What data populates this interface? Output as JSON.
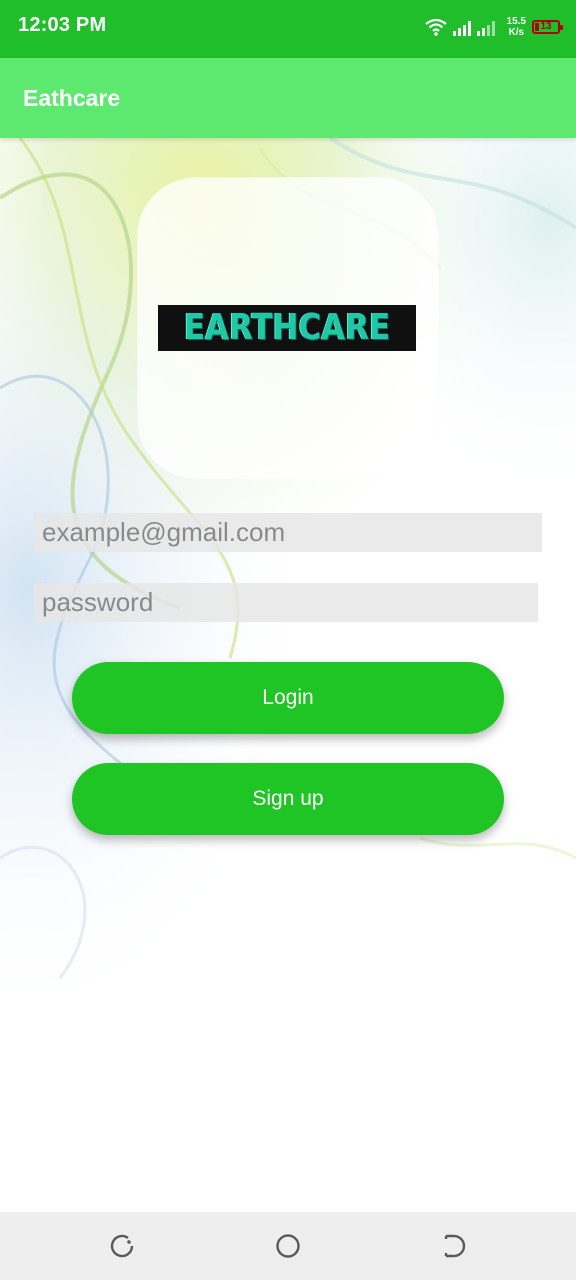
{
  "status_bar": {
    "time": "12:03 PM",
    "net_speed_value": "15.5",
    "net_speed_unit": "K/s",
    "battery_level": "13",
    "icons": [
      "wifi-icon",
      "signal-icon",
      "battery-icon"
    ],
    "background_color": "#1fbe2a"
  },
  "app_bar": {
    "title": "Eathcare",
    "background_color": "#5de86f"
  },
  "logo": {
    "text": "EARTHCARE",
    "text_color": "#1fc9a8"
  },
  "form": {
    "email_placeholder": "example@gmail.com",
    "email_value": "",
    "password_placeholder": "password",
    "password_value": ""
  },
  "buttons": {
    "login_label": "Login",
    "signup_label": "Sign up",
    "color": "#1fc425"
  },
  "nav_bar": {
    "icons": [
      "recents-icon",
      "home-icon",
      "back-icon"
    ]
  }
}
